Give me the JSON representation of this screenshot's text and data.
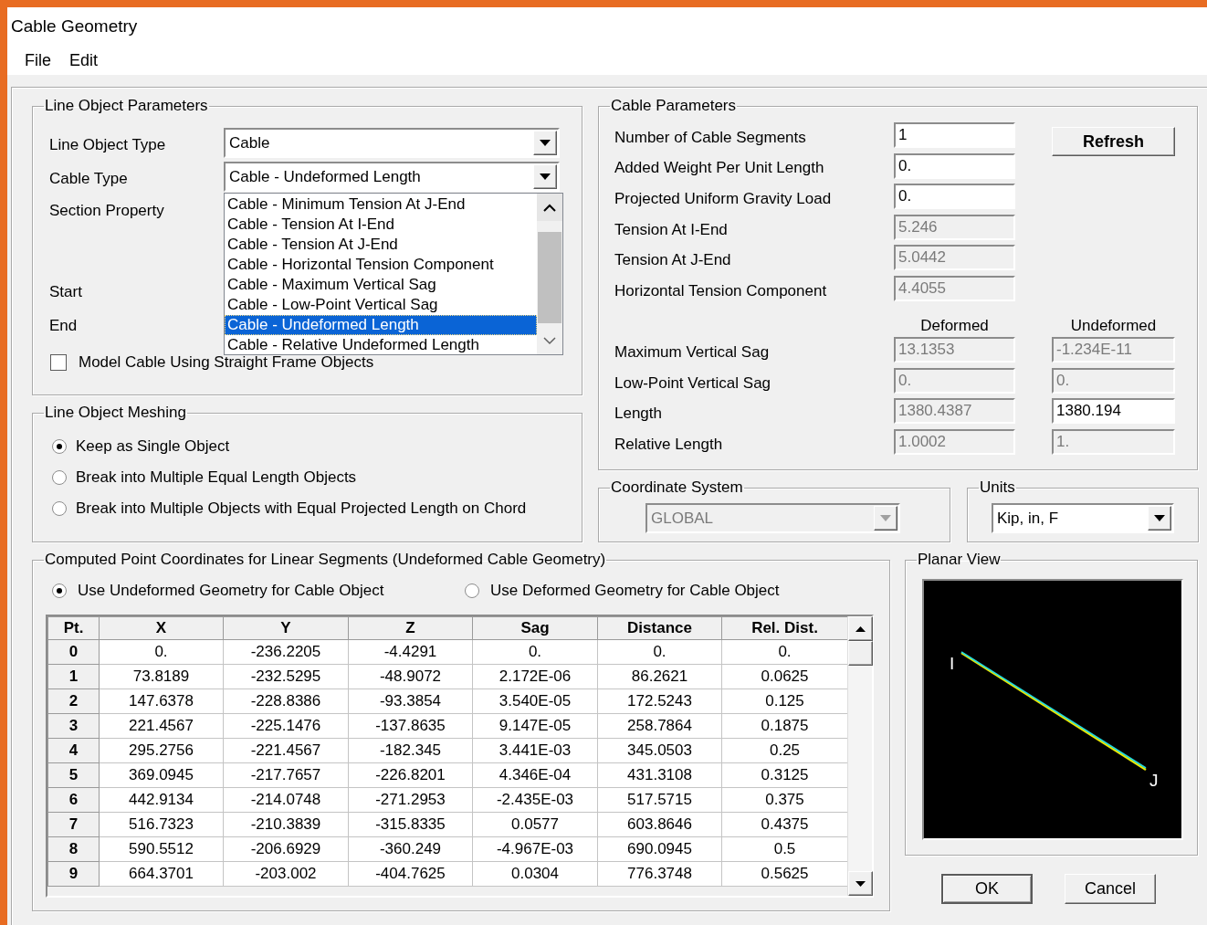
{
  "window": {
    "title": "Cable Geometry"
  },
  "menu": [
    {
      "label": "File"
    },
    {
      "label": "Edit"
    }
  ],
  "line_object_parameters": {
    "title": "Line Object Parameters",
    "fields": [
      {
        "label": "Line Object Type",
        "value": "Cable"
      },
      {
        "label": "Cable Type",
        "value": "Cable - Undeformed Length",
        "expanded": true
      }
    ],
    "other_labels": [
      "Section Property",
      "Start",
      "End"
    ],
    "dropdown_options": [
      {
        "label": "Cable - Minimum Tension At J-End",
        "selected": false
      },
      {
        "label": "Cable - Tension At I-End",
        "selected": false
      },
      {
        "label": "Cable - Tension At J-End",
        "selected": false
      },
      {
        "label": "Cable - Horizontal Tension Component",
        "selected": false
      },
      {
        "label": "Cable - Maximum Vertical Sag",
        "selected": false
      },
      {
        "label": "Cable - Low-Point Vertical Sag",
        "selected": false
      },
      {
        "label": "Cable - Undeformed Length",
        "selected": true
      },
      {
        "label": "Cable - Relative Undeformed Length",
        "selected": false
      }
    ],
    "checkbox": {
      "label": "Model Cable Using Straight Frame Objects",
      "checked": false
    }
  },
  "line_object_meshing": {
    "title": "Line Object Meshing",
    "options": [
      {
        "label": "Keep as Single Object",
        "selected": true
      },
      {
        "label": "Break into Multiple Equal Length Objects",
        "selected": false
      },
      {
        "label": "Break into Multiple Objects with Equal Projected Length on Chord",
        "selected": false
      }
    ]
  },
  "cable_parameters": {
    "title": "Cable Parameters",
    "refresh_button": "Refresh",
    "rows": [
      {
        "label": "Number of Cable Segments",
        "value": "1",
        "disabled": false
      },
      {
        "label": "Added Weight Per Unit Length",
        "value": "0.",
        "disabled": false
      },
      {
        "label": "Projected Uniform Gravity Load",
        "value": "0.",
        "disabled": false
      },
      {
        "label": "Tension At I-End",
        "value": "5.246",
        "disabled": true
      },
      {
        "label": "Tension At J-End",
        "value": "5.0442",
        "disabled": true
      },
      {
        "label": "Horizontal Tension Component",
        "value": "4.4055",
        "disabled": true
      }
    ],
    "column_headers": [
      "Deformed",
      "Undeformed"
    ],
    "compare_rows": [
      {
        "label": "Maximum Vertical Sag",
        "deformed": {
          "value": "13.1353",
          "disabled": true
        },
        "undeformed": {
          "value": "-1.234E-11",
          "disabled": true
        }
      },
      {
        "label": "Low-Point Vertical Sag",
        "deformed": {
          "value": "0.",
          "disabled": true
        },
        "undeformed": {
          "value": "0.",
          "disabled": true
        }
      },
      {
        "label": "Length",
        "deformed": {
          "value": "1380.4387",
          "disabled": true
        },
        "undeformed": {
          "value": "1380.194",
          "disabled": false
        }
      },
      {
        "label": "Relative Length",
        "deformed": {
          "value": "1.0002",
          "disabled": true
        },
        "undeformed": {
          "value": "1.",
          "disabled": true
        }
      }
    ]
  },
  "coordinate_system": {
    "title": "Coordinate System",
    "value": "GLOBAL",
    "disabled": true
  },
  "units": {
    "title": "Units",
    "value": "Kip, in, F",
    "disabled": false
  },
  "computed_points": {
    "title": "Computed Point Coordinates for Linear Segments  (Undeformed Cable Geometry)",
    "geometry_options": [
      {
        "label": "Use Undeformed Geometry for Cable Object",
        "selected": true
      },
      {
        "label": "Use Deformed Geometry for Cable Object",
        "selected": false
      }
    ],
    "table": {
      "columns": [
        "Pt.",
        "X",
        "Y",
        "Z",
        "Sag",
        "Distance",
        "Rel. Dist."
      ],
      "rows": [
        [
          "0",
          "0.",
          "-236.2205",
          "-4.4291",
          "0.",
          "0.",
          "0."
        ],
        [
          "1",
          "73.8189",
          "-232.5295",
          "-48.9072",
          "2.172E-06",
          "86.2621",
          "0.0625"
        ],
        [
          "2",
          "147.6378",
          "-228.8386",
          "-93.3854",
          "3.540E-05",
          "172.5243",
          "0.125"
        ],
        [
          "3",
          "221.4567",
          "-225.1476",
          "-137.8635",
          "9.147E-05",
          "258.7864",
          "0.1875"
        ],
        [
          "4",
          "295.2756",
          "-221.4567",
          "-182.345",
          "3.441E-03",
          "345.0503",
          "0.25"
        ],
        [
          "5",
          "369.0945",
          "-217.7657",
          "-226.8201",
          "4.346E-04",
          "431.3108",
          "0.3125"
        ],
        [
          "6",
          "442.9134",
          "-214.0748",
          "-271.2953",
          "-2.435E-03",
          "517.5715",
          "0.375"
        ],
        [
          "7",
          "516.7323",
          "-210.3839",
          "-315.8335",
          "0.0577",
          "603.8646",
          "0.4375"
        ],
        [
          "8",
          "590.5512",
          "-206.6929",
          "-360.249",
          "-4.967E-03",
          "690.0945",
          "0.5"
        ],
        [
          "9",
          "664.3701",
          "-203.002",
          "-404.7625",
          "0.0304",
          "776.3748",
          "0.5625"
        ]
      ]
    }
  },
  "planar_view": {
    "title": "Planar View",
    "end_labels": [
      "I",
      "J"
    ]
  },
  "buttons": [
    {
      "label": "OK",
      "default": true
    },
    {
      "label": "Cancel",
      "default": false
    }
  ]
}
